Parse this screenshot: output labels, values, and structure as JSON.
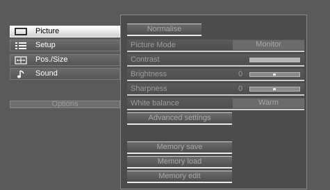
{
  "menu": {
    "items": [
      {
        "label": "Picture",
        "icon": "picture-icon",
        "selected": true
      },
      {
        "label": "Setup",
        "icon": "setup-list-icon",
        "selected": false
      },
      {
        "label": "Pos./Size",
        "icon": "position-size-icon",
        "selected": false
      },
      {
        "label": "Sound",
        "icon": "music-note-icon",
        "selected": false
      }
    ],
    "options_label": "Options"
  },
  "picture_panel": {
    "normalise_label": "Normalise",
    "rows": {
      "picture_mode": {
        "label": "Picture Mode",
        "value": "Monitor"
      },
      "contrast": {
        "label": "Contrast",
        "level": 1.0
      },
      "brightness": {
        "label": "Brightness",
        "value": "0",
        "level": 0.5
      },
      "sharpness": {
        "label": "Sharpness",
        "value": "0",
        "level": 0.5
      },
      "white_balance": {
        "label": "White balance",
        "value": "Warm"
      }
    },
    "advanced_settings_label": "Advanced settings",
    "memory_save_label": "Memory save",
    "memory_load_label": "Memory load",
    "memory_edit_label": "Memory edit"
  },
  "colors": {
    "background": "#5a5a5a",
    "panel": "#4c4c4c",
    "selected_item": "#ffffff",
    "disabled_text": "#9d9d9d"
  }
}
